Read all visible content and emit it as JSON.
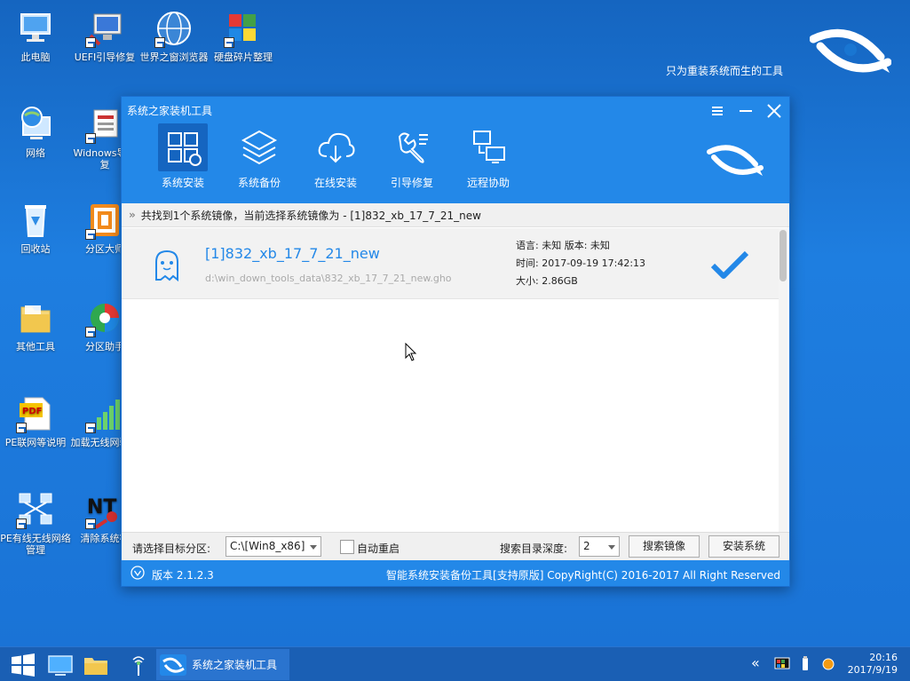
{
  "desktop": {
    "brand_slogan": "只为重装系统而生的工具",
    "icons": [
      {
        "label": "此电脑"
      },
      {
        "label": "UEFI引导修复"
      },
      {
        "label": "世界之窗浏览器"
      },
      {
        "label": "硬盘碎片整理"
      },
      {
        "label": "网络"
      },
      {
        "label": "Widnows导修复"
      },
      {
        "label": "回收站"
      },
      {
        "label": "分区大师"
      },
      {
        "label": "其他工具"
      },
      {
        "label": "分区助手"
      },
      {
        "label": "PE联网等说明"
      },
      {
        "label": "加载无线网驱动"
      },
      {
        "label": "PE有线无线网络管理"
      },
      {
        "label": "清除系统密"
      }
    ]
  },
  "window": {
    "title": "系统之家装机工具",
    "toolbar": [
      {
        "label": "系统安装",
        "icon": "windows-icon",
        "active": true
      },
      {
        "label": "系统备份",
        "icon": "layers-icon"
      },
      {
        "label": "在线安装",
        "icon": "cloud-download-icon"
      },
      {
        "label": "引导修复",
        "icon": "wrench-icon"
      },
      {
        "label": "远程协助",
        "icon": "remote-icon"
      }
    ],
    "info": "共找到1个系统镜像，当前选择系统镜像为 - [1]832_xb_17_7_21_new",
    "image": {
      "name": "[1]832_xb_17_7_21_new",
      "path": "d:\\win_down_tools_data\\832_xb_17_7_21_new.gho",
      "language": "语言: 未知   版本: 未知",
      "time": "时间: 2017-09-19 17:42:13",
      "size": "大小: 2.86GB"
    },
    "bottom": {
      "partition_label": "请选择目标分区:",
      "partition_value": "C:\\[Win8_x86]",
      "auto_reboot_label": "自动重启",
      "depth_label": "搜索目录深度:",
      "depth_value": "2",
      "search_button": "搜索镜像",
      "install_button": "安装系统"
    },
    "status": {
      "version": "版本 2.1.2.3",
      "copyright": "智能系统安装备份工具[支持原版]  CopyRight(C) 2016-2017 All Right Reserved"
    }
  },
  "taskbar": {
    "app_label": "系统之家装机工具",
    "time": "20:16",
    "date": "2017/9/19"
  },
  "colors": {
    "accent": "#2388e8",
    "desktop": "#1976d2"
  }
}
